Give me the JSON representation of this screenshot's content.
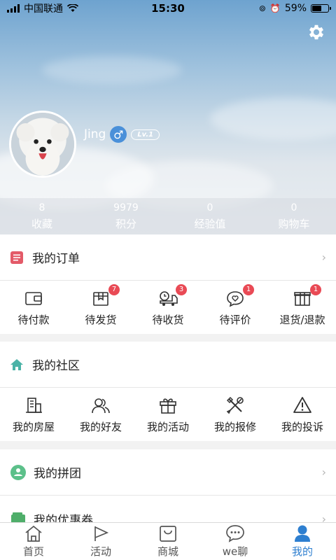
{
  "status_bar": {
    "carrier": "中国联通",
    "time": "15:30",
    "battery": "59%",
    "battery_level": 0.59
  },
  "profile": {
    "username": "Jing",
    "gender_symbol": "♂",
    "level": "Lv.1"
  },
  "stats": [
    {
      "value": "8",
      "label": "收藏"
    },
    {
      "value": "9979",
      "label": "积分"
    },
    {
      "value": "0",
      "label": "经验值"
    },
    {
      "value": "0",
      "label": "购物车"
    }
  ],
  "orders": {
    "title": "我的订单",
    "items": [
      {
        "label": "待付款",
        "icon": "wallet-icon",
        "badge": ""
      },
      {
        "label": "待发货",
        "icon": "package-icon",
        "badge": "7"
      },
      {
        "label": "待收货",
        "icon": "delivery-truck-icon",
        "badge": "3"
      },
      {
        "label": "待评价",
        "icon": "heart-comment-icon",
        "badge": "1"
      },
      {
        "label": "退货/退款",
        "icon": "gift-box-icon",
        "badge": "1"
      }
    ]
  },
  "community": {
    "title": "我的社区",
    "items": [
      {
        "label": "我的房屋",
        "icon": "building-icon"
      },
      {
        "label": "我的好友",
        "icon": "friends-icon"
      },
      {
        "label": "我的活动",
        "icon": "gift-icon"
      },
      {
        "label": "我的报修",
        "icon": "tools-icon"
      },
      {
        "label": "我的投诉",
        "icon": "warning-icon"
      }
    ]
  },
  "rows": [
    {
      "label": "我的拼团",
      "icon": "group-buy-icon"
    },
    {
      "label": "我的优惠券",
      "icon": "coupon-icon"
    }
  ],
  "tabbar": [
    {
      "label": "首页",
      "icon": "home-icon"
    },
    {
      "label": "活动",
      "icon": "flag-icon"
    },
    {
      "label": "商城",
      "icon": "shopping-bag-icon"
    },
    {
      "label": "we聊",
      "icon": "chat-icon"
    },
    {
      "label": "我的",
      "icon": "user-icon",
      "active": true
    }
  ],
  "colors": {
    "accent": "#2e7fd0",
    "badge": "#e94a55",
    "order_icon": "#e35a68",
    "community_icon": "#4bb3a7"
  }
}
